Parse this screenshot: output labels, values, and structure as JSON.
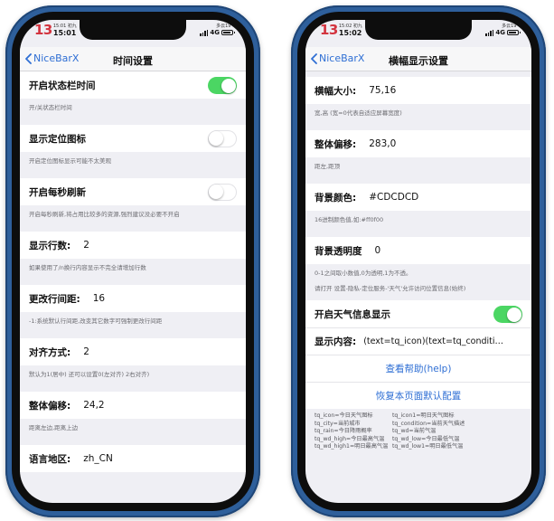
{
  "status_left": {
    "day": "13",
    "top": "15:01 初九",
    "time": "15:01",
    "network": "4G",
    "weather": "多云19°"
  },
  "status_right": {
    "day": "13",
    "top": "15:02 初九",
    "time": "15:02",
    "network": "4G",
    "weather": "多云19°"
  },
  "battery_level": 0.85,
  "accent_blue": "#2f6fd4",
  "toggle_green": "#4bd663",
  "left": {
    "back_label": "NiceBarX",
    "title": "时间设置",
    "rows": {
      "statusbar_time": {
        "label": "开启状态栏时间",
        "desc": "开/关状态栏时间",
        "on": true
      },
      "location_icon": {
        "label": "显示定位图标",
        "desc": "开启定位图标显示可能不太美观",
        "on": false
      },
      "per_second": {
        "label": "开启每秒刷新",
        "desc": "开启每秒刷新,将占用比较多的资源,强烈建议没必要不开启",
        "on": false
      },
      "lines": {
        "label": "显示行数:",
        "value": "2",
        "desc": "如果使用了/n换行内容显示不完全请增加行数"
      },
      "line_spacing": {
        "label": "更改行间距:",
        "value": "16",
        "desc": "-1:系统默认行间距,改变其它数字可强制更改行间距"
      },
      "alignment": {
        "label": "对齐方式:",
        "value": "2",
        "desc": "默认为1(居中) 还可以设置0(左对齐) 2右对齐)"
      },
      "offset": {
        "label": "整体偏移:",
        "value": "24,2",
        "desc": "距离左边,距离上边"
      },
      "locale": {
        "label": "语言地区:",
        "value": "zh_CN"
      }
    }
  },
  "right": {
    "back_label": "NiceBarX",
    "title": "横幅显示设置",
    "rows": {
      "banner_size": {
        "label": "横幅大小:",
        "value": "75,16",
        "desc": "宽,高 (宽=0代表自适应屏幕宽度)"
      },
      "offset": {
        "label": "整体偏移:",
        "value": "283,0",
        "desc": "距左,距顶"
      },
      "bg_color": {
        "label": "背景颜色:",
        "value": "#CDCDCD",
        "desc": "16进制颜色值,如:#ff0f00"
      },
      "bg_alpha": {
        "label": "背景透明度",
        "value": "0",
        "desc": "0-1之间取小数值,0为透明,1为不透。"
      },
      "weather_note": "请打开 设置-隐私-定位服务-'天气'允许访问位置信息(始终)",
      "weather_show": {
        "label": "开启天气信息显示",
        "on": true
      },
      "display_content": {
        "label": "显示内容:",
        "value": "(text=tq_icon)(text=tq_condition,siz..."
      },
      "help_link": "查看帮助(help)",
      "reset_link": "恢复本页面默认配置",
      "legend": [
        [
          "tq_icon=今日天气图标",
          "tq_icon1=明日天气图标"
        ],
        [
          "tq_city=当前城市",
          "tq_condition=当前天气描述"
        ],
        [
          "tq_rain=今日降雨概率",
          "tq_wd=当前气温"
        ],
        [
          "tq_wd_high=今日最高气温",
          "tq_wd_low=今日最低气温"
        ],
        [
          "tq_wd_high1=明日最高气温",
          "tq_wd_low1=明日最低气温"
        ]
      ]
    }
  }
}
